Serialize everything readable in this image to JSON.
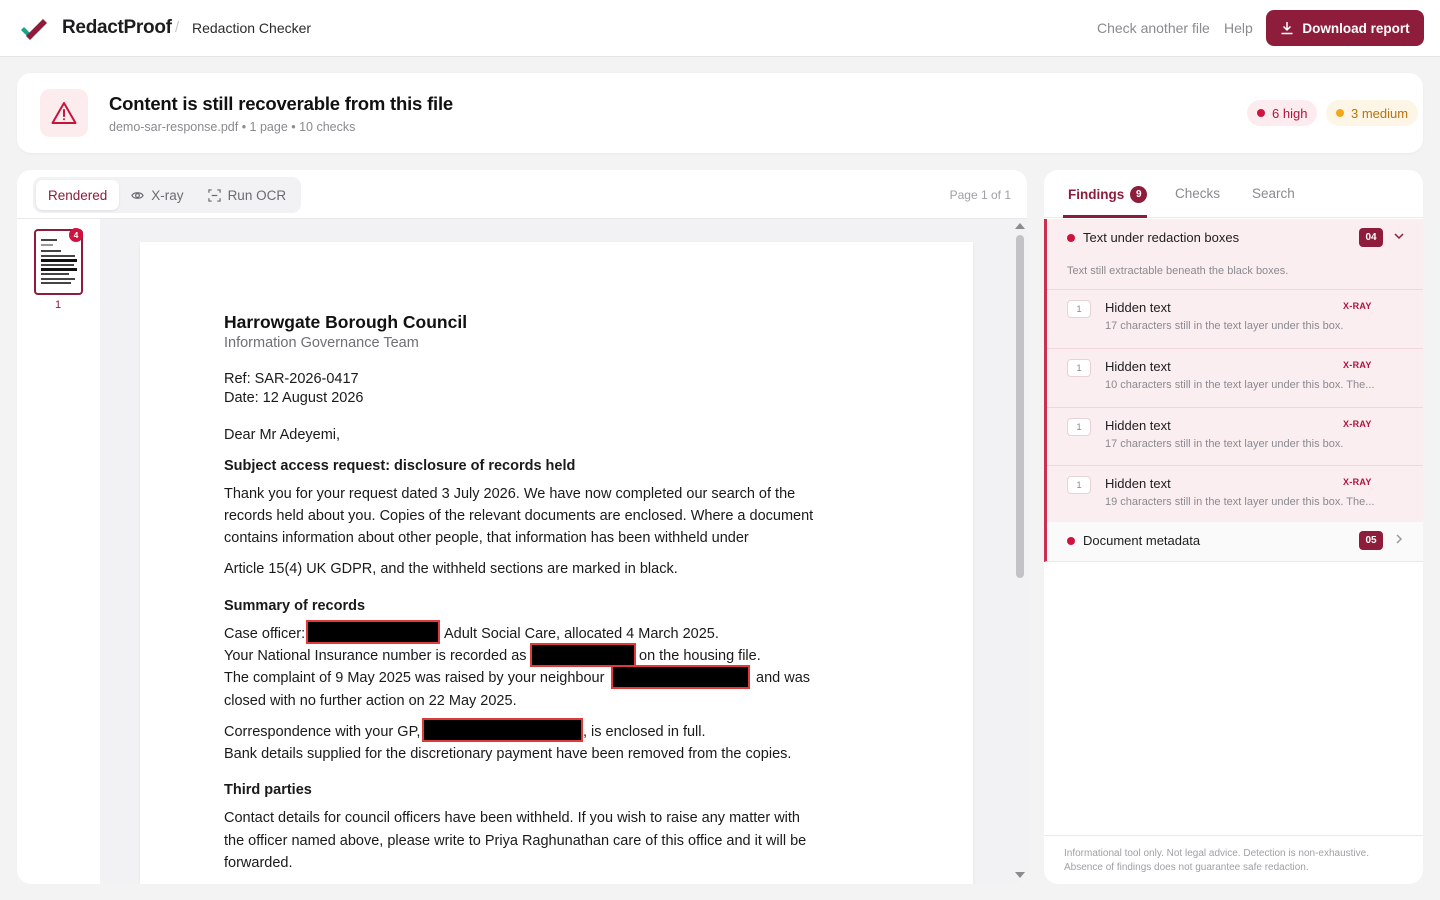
{
  "header": {
    "brand": "RedactProof",
    "separator": "/",
    "crumb": "Redaction Checker",
    "nav_check": "Check another file",
    "nav_help": "Help",
    "download_label": "Download report",
    "accent_color": "#8e1d3b"
  },
  "alert": {
    "icon": "warning-triangle-icon",
    "title": "Content is still recoverable from this file",
    "subtitle": "demo-sar-response.pdf • 1 page • 10 checks",
    "high_label": "6 high",
    "medium_label": "3 medium"
  },
  "viewer": {
    "tabs": [
      {
        "label": "Rendered",
        "icon": ""
      },
      {
        "label": "X-ray",
        "icon": "eye-icon"
      },
      {
        "label": "Run OCR",
        "icon": "scan-icon"
      }
    ],
    "active_tab": "Rendered",
    "page_indicator": "Page 1 of 1",
    "thumbnail_badge": "4",
    "thumbnail_number": "1"
  },
  "document": {
    "org": "Harrowgate Borough Council",
    "team": "Information Governance Team",
    "ref": "Ref: SAR-2026-0417",
    "date": "Date: 12 August 2026",
    "greeting": "Dear Mr Adeyemi,",
    "subject": "Subject access request: disclosure of records held",
    "para1": [
      "Thank you for your request dated 3 July 2026. We have now completed our search of the",
      "records held about you. Copies of the relevant documents are enclosed. Where a document",
      "contains information about other people, that information has been withheld under"
    ],
    "para2": "Article 15(4) UK GDPR, and the withheld sections are marked in black.",
    "summary_heading": "Summary of records",
    "summary": {
      "line1a": "Case officer:",
      "line1b": "Adult Social Care, allocated 4 March 2025.",
      "line2a": "Your National Insurance number is recorded as",
      "line2b": "on the housing file.",
      "line3a": "The complaint of 9 May 2025 was raised by your neighbour",
      "line3b": "and was",
      "line4": "closed with no further action on 22 May 2025.",
      "line5a": "Correspondence with your GP,",
      "line5b": ", is enclosed in full.",
      "line6": "Bank details supplied for the discretionary payment have been removed from the copies."
    },
    "third_heading": "Third parties",
    "third": [
      "Contact details for council officers have been withheld. If you wish to raise any matter with",
      "the officer named above, please write to Priya Raghunathan care of this office and it will be",
      "forwarded."
    ]
  },
  "findings_panel": {
    "tabs": {
      "findings": "Findings",
      "findings_count": "9",
      "checks": "Checks",
      "search": "Search"
    },
    "groups": [
      {
        "title": "Text under redaction boxes",
        "badge": "04",
        "description": "Text still extractable beneath the black boxes.",
        "expanded": true,
        "items": [
          {
            "num": "1",
            "title": "Hidden text",
            "tag": "X-RAY",
            "desc": "17 characters still in the text layer under this box."
          },
          {
            "num": "1",
            "title": "Hidden text",
            "tag": "X-RAY",
            "desc": "10 characters still in the text layer under this box. The..."
          },
          {
            "num": "1",
            "title": "Hidden text",
            "tag": "X-RAY",
            "desc": "17 characters still in the text layer under this box."
          },
          {
            "num": "1",
            "title": "Hidden text",
            "tag": "X-RAY",
            "desc": "19 characters still in the text layer under this box. The..."
          }
        ]
      },
      {
        "title": "Document metadata",
        "badge": "05",
        "expanded": false
      }
    ],
    "footer": "Informational tool only. Not legal advice. Detection is non-exhaustive. Absence of findings does not guarantee safe redaction."
  }
}
